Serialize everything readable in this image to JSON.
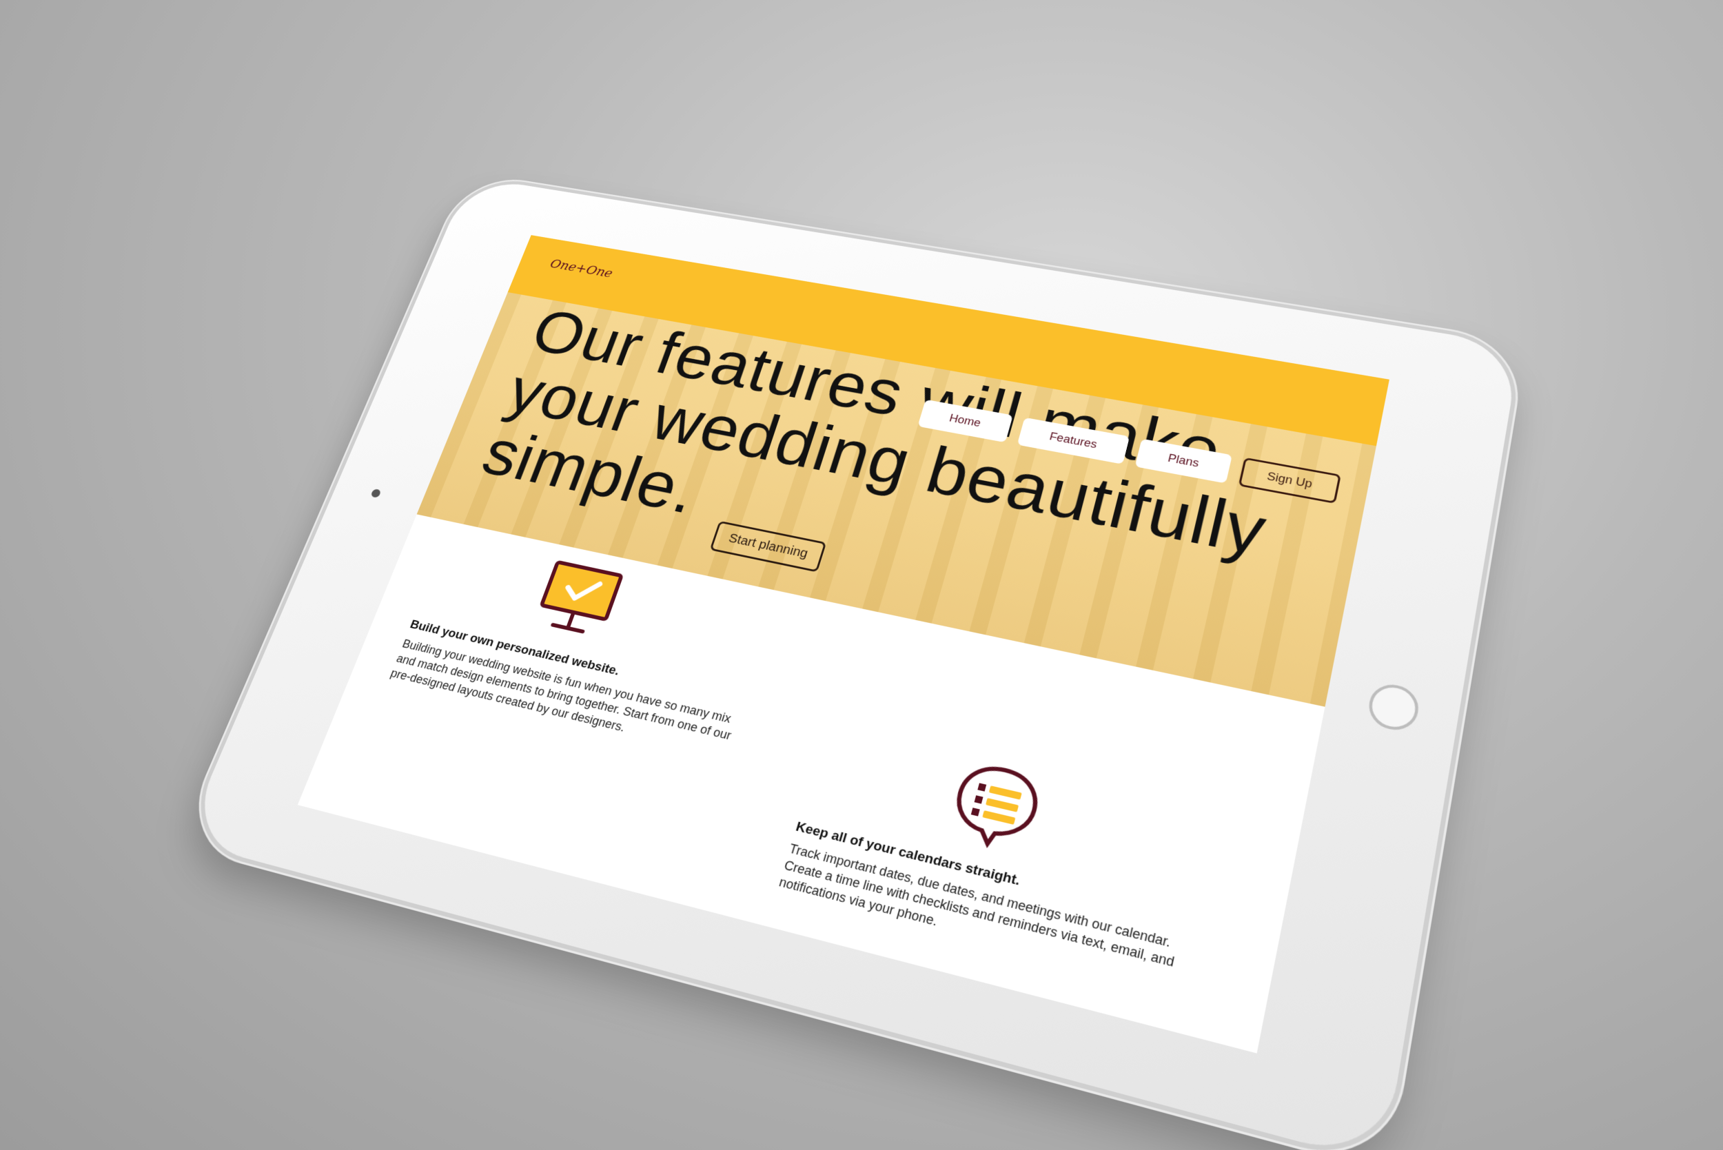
{
  "site": {
    "logo": "One+One",
    "nav": {
      "home": "Home",
      "features": "Features",
      "plans": "Plans",
      "signup": "Sign Up"
    },
    "hero": {
      "headline": "Our features will make your wedding beautifully simple.",
      "cta": "Start planning"
    },
    "features": [
      {
        "icon": "monitor-check-icon",
        "title": "Build your own personalized website.",
        "text": "Building your wedding website is fun when you have so many mix and match design elements to bring together. Start from one of our pre-designed layouts created by our designers."
      },
      {
        "icon": "checklist-chat-icon",
        "title": "Keep all of your calendars straight.",
        "text": "Track important dates, due dates, and meetings with our calendar. Create a time line with checklists and reminders via text, email, and notifications via your phone."
      }
    ]
  },
  "colors": {
    "accent_yellow": "#fbbf2a",
    "hero_tint": "#f3d288",
    "maroon": "#5a1020",
    "background_gray": "#b9b9b9",
    "tablet_white": "#f4f4f4"
  }
}
